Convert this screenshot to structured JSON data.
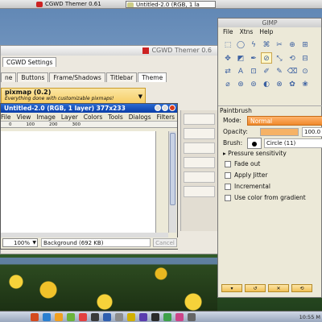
{
  "taskbar": {
    "apps": [
      {
        "label": "CGWD Themer 0.61",
        "active": false
      },
      {
        "label": "Untitled-2.0 (RGB, 1 la",
        "active": true
      }
    ]
  },
  "cgwd": {
    "title": "CGWD Themer 0.6",
    "top_tabs": [
      "CGWD Settings"
    ],
    "tabs": [
      "ne",
      "Buttons",
      "Frame/Shadows",
      "Titlebar",
      "Theme"
    ],
    "pixmap_title": "pixmap (0.2)",
    "pixmap_sub": "Everything done with customizable pixmaps!"
  },
  "image_window": {
    "title": "Untitled-2.0 (RGB, 1 layer) 377x233",
    "menu": [
      "File",
      "View",
      "Image",
      "Layer",
      "Colors",
      "Tools",
      "Dialogs",
      "Filters"
    ],
    "ruler_ticks": [
      "0",
      "100",
      "200",
      "300"
    ],
    "zoom": "100%",
    "status": "Background (692 KB)",
    "cancel": "Cancel"
  },
  "toolbox": {
    "title": "GIMP",
    "menu": [
      "File",
      "Xtns",
      "Help"
    ],
    "tools": [
      "⬚",
      "◯",
      "ϟ",
      "⌘",
      "✂",
      "⊕",
      "⊞",
      "✥",
      "◩",
      "✒",
      "⊘",
      "⤡",
      "⟲",
      "⊟",
      "⇄",
      "A",
      "⊡",
      "✐",
      "✎",
      "⌫",
      "⊙",
      "⌀",
      "⊛",
      "⊚",
      "◐",
      "⊗",
      "✿",
      "❀"
    ],
    "active_tool_index": 10
  },
  "tool_options": {
    "title": "Paintbrush",
    "mode_label": "Mode:",
    "mode_value": "Normal",
    "opacity_label": "Opacity:",
    "opacity_value": "100.0",
    "opacity_fraction": 1.0,
    "brush_label": "Brush:",
    "brush_value": "Circle (11)",
    "pressure": "Pressure sensitivity",
    "checkboxes": [
      "Fade out",
      "Apply Jitter",
      "Incremental",
      "Use color from gradient"
    ]
  },
  "dock": {
    "clock": "10:55 M",
    "icon_colors": [
      "#d44a1e",
      "#2a7fd0",
      "#f0a020",
      "#6cb33a",
      "#e24040",
      "#3a3a3a",
      "#2f5fb0",
      "#8c8c8c",
      "#d0b000",
      "#5a3cae",
      "#2a2a2a",
      "#3fa04a",
      "#cc4488",
      "#666666"
    ]
  }
}
